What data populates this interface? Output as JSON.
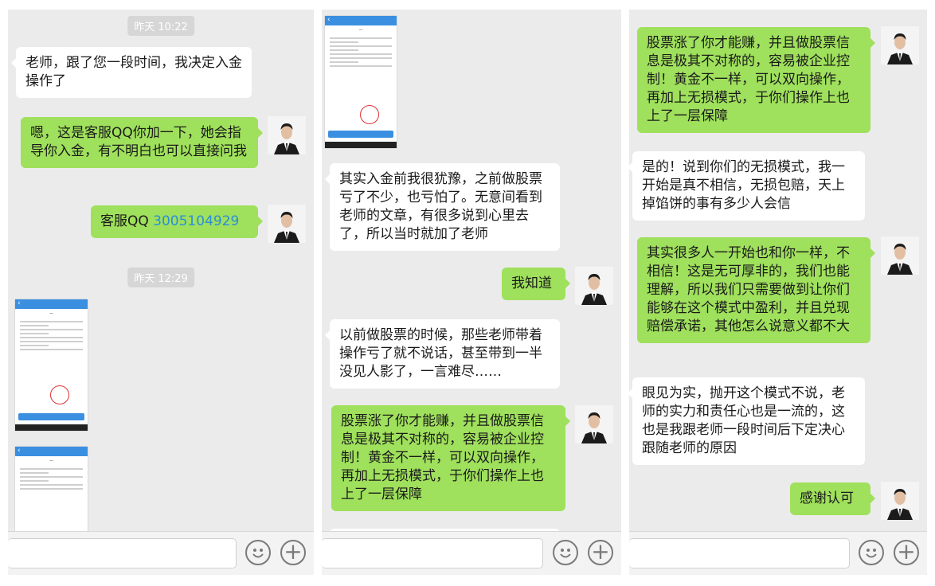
{
  "panels": [
    {
      "timestamps": [
        "昨天 10:22",
        "昨天 12:29"
      ],
      "messages": [
        {
          "side": "in",
          "text": "老师，跟了您一段时间，我决定入金操作了"
        },
        {
          "side": "out",
          "text": "嗯，这是客服QQ你加一下，她会指导你入金，有不明白也可以直接问我"
        },
        {
          "side": "out",
          "label": "客服QQ ",
          "qq": "3005104929"
        }
      ]
    },
    {
      "messages": [
        {
          "side": "in",
          "text": "其实入金前我很犹豫，之前做股票亏了不少，也亏怕了。无意间看到老师的文章，有很多说到心里去了，所以当时就加了老师"
        },
        {
          "side": "out",
          "text": "我知道"
        },
        {
          "side": "in",
          "text": "以前做股票的时候，那些老师带着操作亏了就不说话，甚至带到一半没见人影了，一言难尽……"
        },
        {
          "side": "out",
          "text": "股票涨了你才能赚，并且做股票信息是极其不对称的，容易被企业控制！黄金不一样，可以双向操作，再加上无损模式，于你们操作上也上了一层保障"
        }
      ]
    },
    {
      "messages": [
        {
          "side": "out",
          "text": "股票涨了你才能赚，并且做股票信息是极其不对称的，容易被企业控制！黄金不一样，可以双向操作，再加上无损模式，于你们操作上也上了一层保障"
        },
        {
          "side": "in",
          "text": "是的！说到你们的无损模式，我一开始是真不相信，无损包赔，天上掉馅饼的事有多少人会信"
        },
        {
          "side": "out",
          "text": "其实很多人一开始也和你一样，不相信！这是无可厚非的，我们也能理解，所以我们只需要做到让你们能够在这个模式中盈利，并且兑现赔偿承诺，其他怎么说意义都不大"
        },
        {
          "side": "in",
          "text": "眼见为实，抛开这个模式不说，老师的实力和责任心也是一流的，这也是我跟老师一段时间后下定决心跟随老师的原因"
        },
        {
          "side": "out",
          "text": "感谢认可"
        }
      ]
    }
  ],
  "input_bar": {
    "emoji_icon": "emoji-icon",
    "plus_icon": "plus-icon",
    "plus_glyph": "+"
  },
  "colors": {
    "bg": "#ebebeb",
    "out_bubble": "#9fe05c",
    "in_bubble": "#ffffff",
    "qq_link": "#2b8ed6"
  }
}
